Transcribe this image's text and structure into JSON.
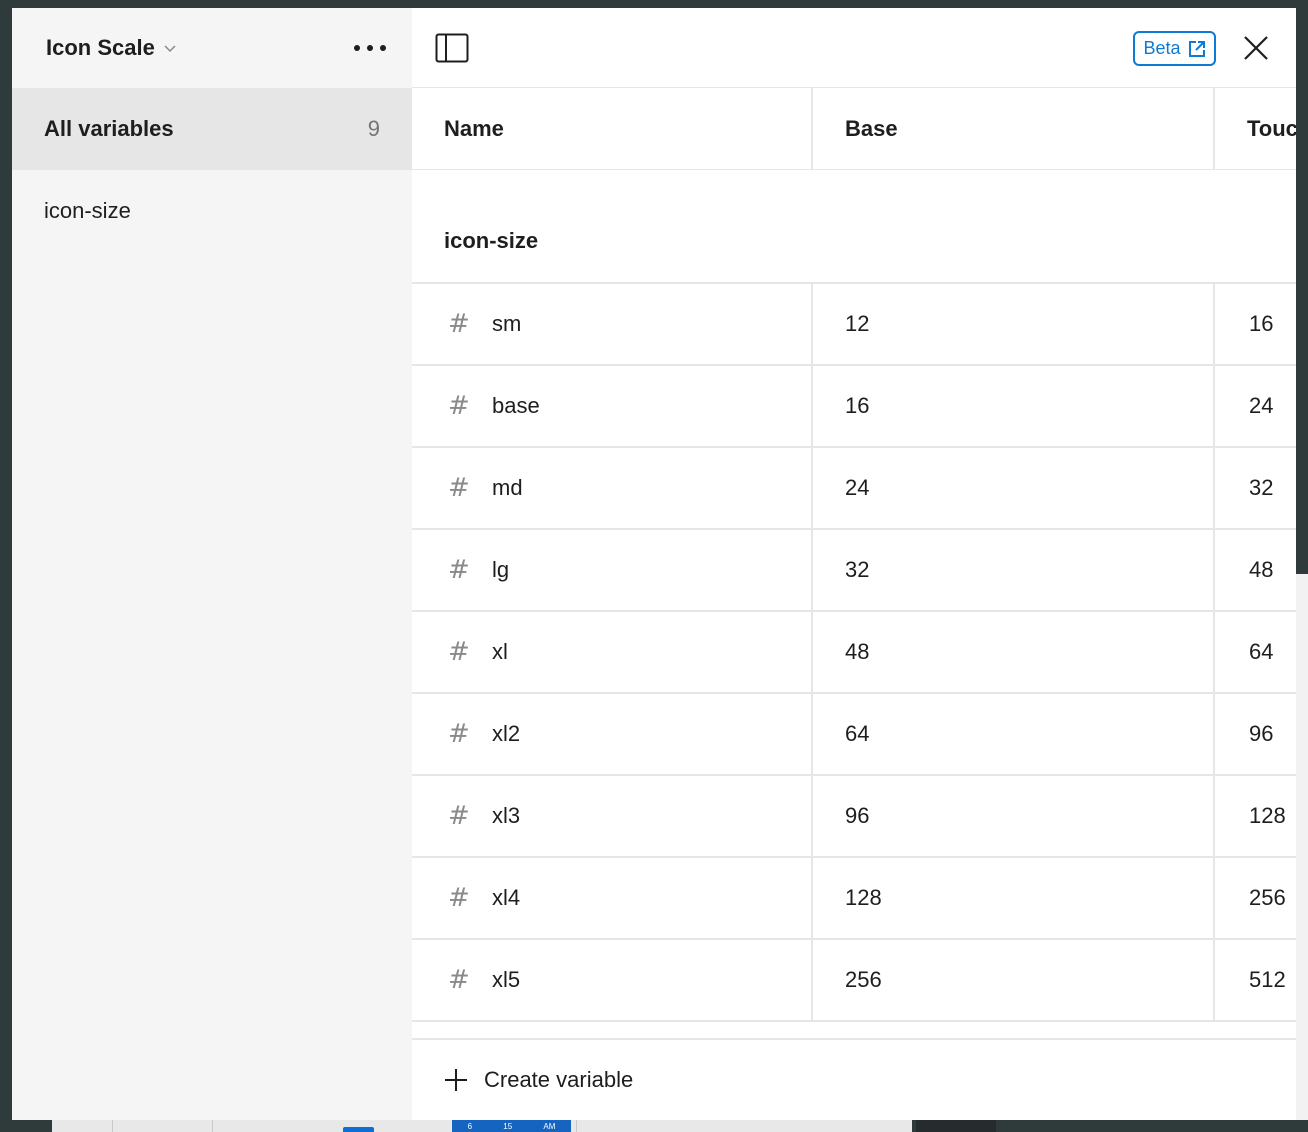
{
  "sidebar": {
    "collection_title": "Icon Scale",
    "items": [
      {
        "label": "All variables",
        "count": "9"
      },
      {
        "label": "icon-size"
      }
    ]
  },
  "toolbar": {
    "beta_label": "Beta"
  },
  "table": {
    "headers": [
      "Name",
      "Base",
      "Touch"
    ],
    "group_label": "icon-size",
    "rows": [
      {
        "name": "sm",
        "base": "12",
        "touch": "16"
      },
      {
        "name": "base",
        "base": "16",
        "touch": "24"
      },
      {
        "name": "md",
        "base": "24",
        "touch": "32"
      },
      {
        "name": "lg",
        "base": "32",
        "touch": "48"
      },
      {
        "name": "xl",
        "base": "48",
        "touch": "64"
      },
      {
        "name": "xl2",
        "base": "64",
        "touch": "96"
      },
      {
        "name": "xl3",
        "base": "96",
        "touch": "128"
      },
      {
        "name": "xl4",
        "base": "128",
        "touch": "256"
      },
      {
        "name": "xl5",
        "base": "256",
        "touch": "512"
      }
    ]
  },
  "footer": {
    "create_label": "Create variable"
  },
  "background": {
    "time_labels": [
      "6",
      "15",
      "AM"
    ]
  },
  "colors": {
    "accent": "#0d7ad6",
    "sidebar_bg": "#f5f5f5",
    "active_item_bg": "#e6e6e6"
  }
}
